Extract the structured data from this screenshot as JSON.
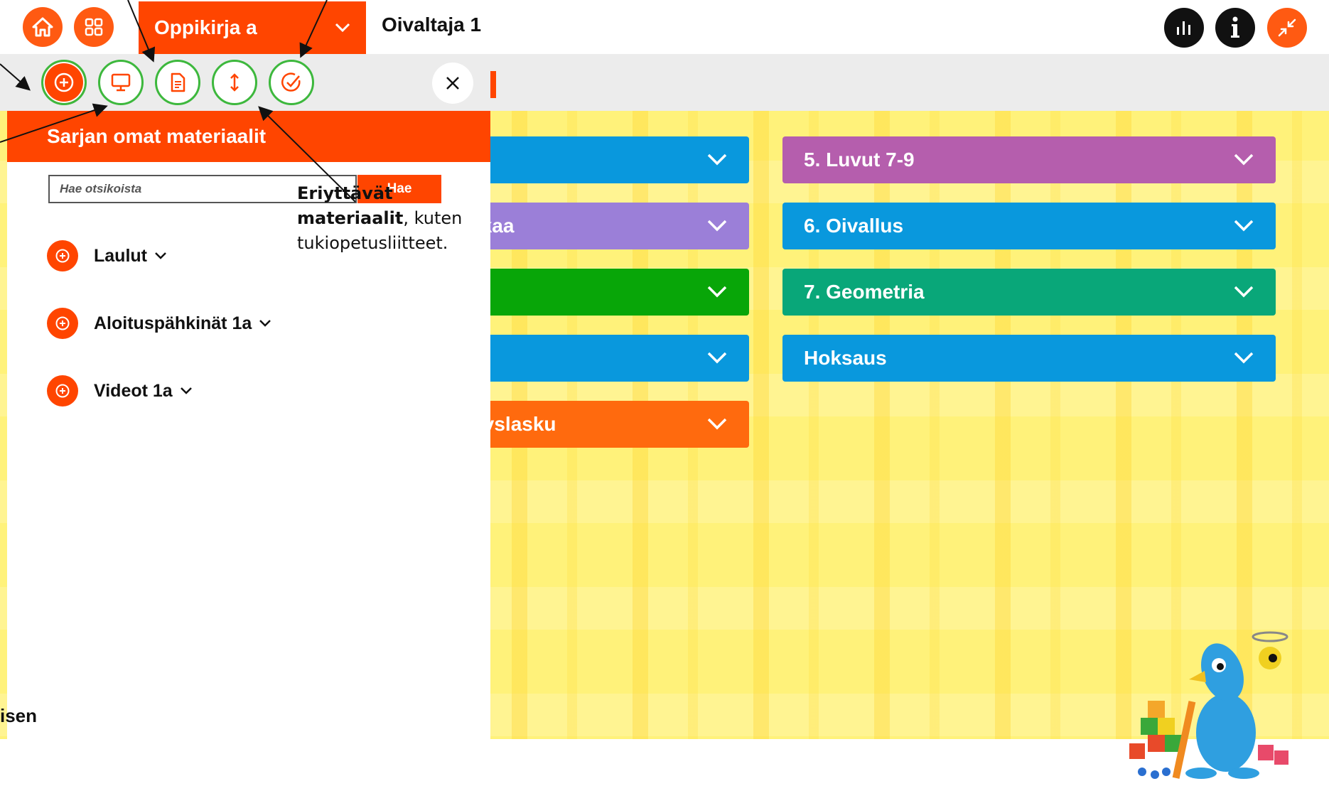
{
  "topbar": {
    "book_selector": "Oppikirja a",
    "book_title": "Oivaltaja 1"
  },
  "panel": {
    "header": "Sarjan omat materiaalit",
    "search": {
      "placeholder": "Hae otsikoista",
      "button": "Hae"
    },
    "categories": [
      {
        "label": "Laulut"
      },
      {
        "label": "Aloituspähkinät 1a"
      },
      {
        "label": "Videot 1a"
      }
    ]
  },
  "chapters_left": [
    {
      "label": "",
      "color": "#0998dd"
    },
    {
      "label": "a alkaa",
      "color": "#9b7fd8"
    },
    {
      "label": "",
      "color": "#08a608"
    },
    {
      "label": "",
      "color": "#0998dd"
    },
    {
      "label": "ennyslasku",
      "color": "#ff6a0e"
    }
  ],
  "chapters_right": [
    {
      "label": "5. Luvut 7-9",
      "color": "#b55ead"
    },
    {
      "label": "6. Oivallus",
      "color": "#0998dd"
    },
    {
      "label": "7. Geometria",
      "color": "#09a779"
    },
    {
      "label": "Hoksaus",
      "color": "#0998dd"
    }
  ],
  "annotation": {
    "bold1": "Eriyttävät",
    "bold2": "materiaalit",
    "rest1": ", kuten",
    "rest2": "tukiopetusliitteet."
  },
  "stray_text": "isen",
  "colors": {
    "accent": "#ff4500",
    "tool_ring": "#3db83d",
    "background": "#fff27a"
  }
}
